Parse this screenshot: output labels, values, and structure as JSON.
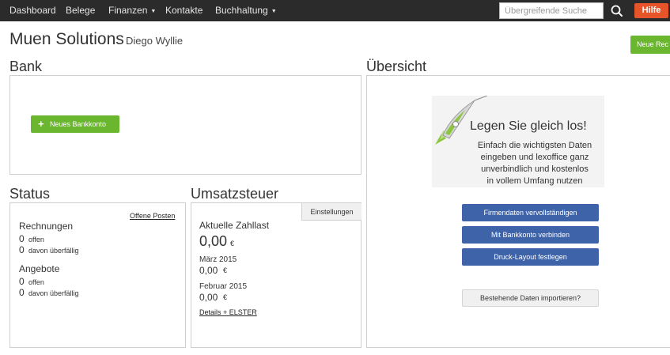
{
  "nav": {
    "items": [
      {
        "label": "Dashboard"
      },
      {
        "label": "Belege"
      },
      {
        "label": "Finanzen",
        "dropdown": true
      },
      {
        "label": "Kontakte"
      },
      {
        "label": "Buchhaltung",
        "dropdown": true
      }
    ],
    "search_placeholder": "Übergreifende Suche",
    "help_label": "Hilfe"
  },
  "header": {
    "company": "Muen Solutions",
    "user": "Diego Wyllie",
    "new_invoice_label": "Neue Rec"
  },
  "bank": {
    "title": "Bank",
    "new_account_label": "Neues Bankkonto"
  },
  "status": {
    "title": "Status",
    "open_items_link": "Offene Posten",
    "invoices": {
      "heading": "Rechnungen",
      "open_count": "0",
      "open_label": "offen",
      "overdue_count": "0",
      "overdue_label": "davon überfällig"
    },
    "offers": {
      "heading": "Angebote",
      "open_count": "0",
      "open_label": "offen",
      "overdue_count": "0",
      "overdue_label": "davon überfällig"
    }
  },
  "vat": {
    "title": "Umsatzsteuer",
    "settings_label": "Einstellungen",
    "current_heading": "Aktuelle Zahllast",
    "current_value": "0,00",
    "currency": "€",
    "periods": [
      {
        "label": "März 2015",
        "value": "0,00"
      },
      {
        "label": "Februar 2015",
        "value": "0,00"
      }
    ],
    "details_link": "Details + ELSTER"
  },
  "overview": {
    "title": "Übersicht",
    "promo_title": "Legen Sie gleich los!",
    "promo_lines": [
      "Einfach die wichtigsten Daten",
      "eingeben und lexoffice ganz",
      "unverbindlich und kostenlos",
      "in vollem Umfang nutzen"
    ],
    "actions": [
      "Firmendaten vervollständigen",
      "Mit Bankkonto verbinden",
      "Druck-Layout festlegen"
    ],
    "import_label": "Bestehende Daten importieren?"
  },
  "colors": {
    "nav_bg": "#2b2b2b",
    "accent_green": "#6ab72f",
    "accent_blue": "#3f63a8",
    "help_orange": "#e8542a"
  }
}
